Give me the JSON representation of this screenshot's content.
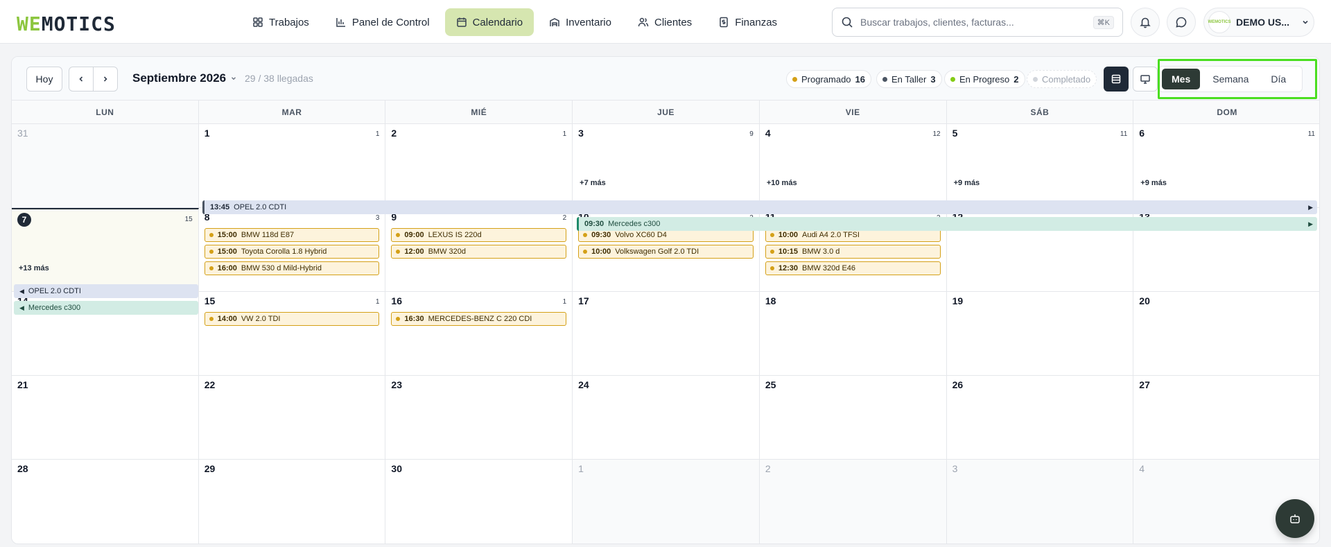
{
  "logo": {
    "part_a": "WE",
    "part_b": "MOTICS"
  },
  "nav": [
    {
      "label": "Trabajos",
      "icon": "grid-icon"
    },
    {
      "label": "Panel de Control",
      "icon": "bar-chart-icon"
    },
    {
      "label": "Calendario",
      "icon": "calendar-icon",
      "active": true
    },
    {
      "label": "Inventario",
      "icon": "warehouse-icon"
    },
    {
      "label": "Clientes",
      "icon": "users-icon"
    },
    {
      "label": "Finanzas",
      "icon": "dollar-file-icon"
    }
  ],
  "search": {
    "placeholder": "Buscar trabajos, clientes, facturas...",
    "shortcut": "⌘K"
  },
  "user": {
    "name": "DEMO US...",
    "avatar_text": "WEMOTICS"
  },
  "toolbar": {
    "today_label": "Hoy",
    "month_label": "Septiembre 2026",
    "arrivals": "29 / 38 llegadas",
    "legend": [
      {
        "label": "Programado",
        "count": "16",
        "color": "#d4a017"
      },
      {
        "label": "En Taller",
        "count": "3",
        "color": "#4b5563"
      },
      {
        "label": "En Progreso",
        "count": "2",
        "color": "#84cc16"
      },
      {
        "label": "Completado",
        "count": "",
        "color": "#d1d5db"
      }
    ],
    "views": [
      "Mes",
      "Semana",
      "Día"
    ],
    "active_view": "Mes"
  },
  "weekdays": [
    "LUN",
    "MAR",
    "MIÉ",
    "JUE",
    "VIE",
    "SÁB",
    "DOM"
  ],
  "weeks": [
    [
      {
        "day": "31",
        "other": true,
        "count": ""
      },
      {
        "day": "1",
        "count": "1"
      },
      {
        "day": "2",
        "count": "1"
      },
      {
        "day": "3",
        "count": "9",
        "more": "+7 más"
      },
      {
        "day": "4",
        "count": "12",
        "more": "+10 más"
      },
      {
        "day": "5",
        "count": "11",
        "more": "+9 más"
      },
      {
        "day": "6",
        "count": "11",
        "more": "+9 más"
      }
    ],
    [
      {
        "day": "7",
        "today": true,
        "count": "15",
        "more": "+13 más"
      },
      {
        "day": "8",
        "count": "3",
        "events": [
          {
            "time": "15:00",
            "title": "BMW 118d E87"
          },
          {
            "time": "15:00",
            "title": "Toyota Corolla 1.8 Hybrid"
          },
          {
            "time": "16:00",
            "title": "BMW 530 d Mild-Hybrid"
          }
        ]
      },
      {
        "day": "9",
        "count": "2",
        "events": [
          {
            "time": "09:00",
            "title": "LEXUS IS 220d"
          },
          {
            "time": "12:00",
            "title": "BMW 320d"
          }
        ]
      },
      {
        "day": "10",
        "count": "2",
        "events": [
          {
            "time": "09:30",
            "title": "Volvo XC60 D4"
          },
          {
            "time": "10:00",
            "title": "Volkswagen Golf 2.0 TDI"
          }
        ]
      },
      {
        "day": "11",
        "count": "3",
        "events": [
          {
            "time": "10:00",
            "title": "Audi A4 2.0 TFSI"
          },
          {
            "time": "10:15",
            "title": "BMW 3.0 d"
          },
          {
            "time": "12:30",
            "title": "BMW 320d E46"
          }
        ]
      },
      {
        "day": "12",
        "count": ""
      },
      {
        "day": "13",
        "count": ""
      }
    ],
    [
      {
        "day": "14",
        "count": ""
      },
      {
        "day": "15",
        "count": "1",
        "events": [
          {
            "time": "14:00",
            "title": "VW 2.0 TDI"
          }
        ]
      },
      {
        "day": "16",
        "count": "1",
        "events": [
          {
            "time": "16:30",
            "title": "MERCEDES-BENZ C 220 CDI"
          }
        ]
      },
      {
        "day": "17",
        "count": ""
      },
      {
        "day": "18",
        "count": ""
      },
      {
        "day": "19",
        "count": ""
      },
      {
        "day": "20",
        "count": ""
      }
    ],
    [
      {
        "day": "21",
        "count": ""
      },
      {
        "day": "22",
        "count": ""
      },
      {
        "day": "23",
        "count": ""
      },
      {
        "day": "24",
        "count": ""
      },
      {
        "day": "25",
        "count": ""
      },
      {
        "day": "26",
        "count": ""
      },
      {
        "day": "27",
        "count": ""
      }
    ],
    [
      {
        "day": "28",
        "count": ""
      },
      {
        "day": "29",
        "count": ""
      },
      {
        "day": "30",
        "count": ""
      },
      {
        "day": "1",
        "other": true,
        "count": ""
      },
      {
        "day": "2",
        "other": true,
        "count": ""
      },
      {
        "day": "3",
        "other": true,
        "count": ""
      },
      {
        "day": "4",
        "other": true,
        "count": ""
      }
    ]
  ],
  "span_events": [
    {
      "time": "13:45",
      "title": "OPEL 2.0 CDTI",
      "kind": "opel"
    },
    {
      "time": "09:30",
      "title": "Mercedes c300",
      "kind": "merc"
    },
    {
      "time": "",
      "title": "OPEL 2.0 CDTI",
      "kind": "opel"
    },
    {
      "time": "",
      "title": "Mercedes c300",
      "kind": "merc"
    }
  ]
}
